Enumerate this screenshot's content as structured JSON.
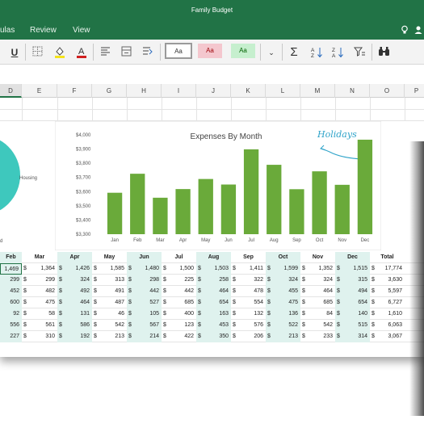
{
  "title_bar": {
    "title": "Family Budget"
  },
  "tabs": [
    "ulas",
    "Review",
    "View"
  ],
  "ribbon": {
    "styles": [
      {
        "label": "Aa",
        "bg": "#ffffff",
        "fg": "#333333",
        "border": "#9a9a9a"
      },
      {
        "label": "Aa",
        "bg": "#f4c7ce",
        "fg": "#9c0006",
        "border": "#f4c7ce"
      },
      {
        "label": "Aa",
        "bg": "#c6efce",
        "fg": "#006100",
        "border": "#c6efce"
      }
    ]
  },
  "columns": [
    "D",
    "E",
    "F",
    "G",
    "H",
    "I",
    "J",
    "K",
    "L",
    "M",
    "N",
    "O",
    "P"
  ],
  "colors": {
    "bar": "#6aaa3a",
    "pie": "#3ec8bd",
    "accent": "#217346",
    "shade": "#dff2ee",
    "annotation": "#2ea3c9"
  },
  "pie": {
    "labels": [
      "Housing",
      "d"
    ]
  },
  "chart_data": {
    "type": "bar",
    "title": "Expenses By Month",
    "categories": [
      "Jan",
      "Feb",
      "Mar",
      "Apr",
      "May",
      "Jun",
      "Jul",
      "Aug",
      "Sep",
      "Oct",
      "Nov",
      "Dec"
    ],
    "values": [
      3592,
      3726,
      3557,
      3618,
      3689,
      3650,
      3898,
      3789,
      3617,
      3743,
      3648,
      3966
    ],
    "ylim": [
      3300,
      4000
    ],
    "yticks": [
      "$3,300",
      "$3,400",
      "$3,500",
      "$3,600",
      "$3,700",
      "$3,800",
      "$3,900",
      "$4,000"
    ],
    "annotation": "Holidays",
    "grid": false
  },
  "table": {
    "headers": [
      "Feb",
      "Mar",
      "Apr",
      "May",
      "Jun",
      "Jul",
      "Aug",
      "Sep",
      "Oct",
      "Nov",
      "Dec",
      "Total"
    ],
    "currency": "$",
    "rows": [
      [
        "1,469",
        "1,364",
        "1,426",
        "1,585",
        "1,480",
        "1,500",
        "1,503",
        "1,411",
        "1,599",
        "1,352",
        "1,515",
        "17,774"
      ],
      [
        "299",
        "299",
        "324",
        "313",
        "298",
        "225",
        "258",
        "322",
        "324",
        "324",
        "315",
        "3,630"
      ],
      [
        "452",
        "482",
        "492",
        "491",
        "442",
        "442",
        "464",
        "478",
        "455",
        "464",
        "494",
        "5,597"
      ],
      [
        "600",
        "475",
        "464",
        "487",
        "527",
        "685",
        "654",
        "554",
        "475",
        "685",
        "654",
        "6,727"
      ],
      [
        "92",
        "58",
        "131",
        "46",
        "105",
        "400",
        "163",
        "132",
        "136",
        "84",
        "140",
        "1,610"
      ],
      [
        "556",
        "561",
        "586",
        "542",
        "567",
        "123",
        "453",
        "576",
        "522",
        "542",
        "515",
        "6,063"
      ],
      [
        "227",
        "310",
        "192",
        "213",
        "214",
        "422",
        "350",
        "206",
        "213",
        "233",
        "314",
        "3,067"
      ]
    ]
  }
}
